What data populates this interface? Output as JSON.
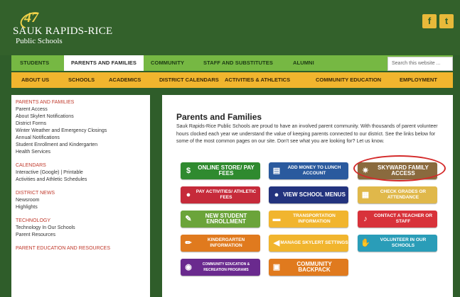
{
  "header": {
    "logo": {
      "number": "47",
      "name": "SAUK RAPIDS-RICE",
      "subtitle": "Public Schools"
    },
    "social": [
      {
        "icon": "facebook-icon",
        "glyph": "f"
      },
      {
        "icon": "twitter-icon",
        "glyph": "t"
      }
    ]
  },
  "nav_primary": {
    "items": [
      "STUDENTS",
      "PARENTS AND FAMILIES",
      "COMMUNITY",
      "STAFF AND SUBSTITUTES",
      "ALUMNI"
    ],
    "active": "PARENTS AND FAMILIES"
  },
  "search": {
    "placeholder": "Search this website ..."
  },
  "nav_secondary": {
    "items": [
      "ABOUT US",
      "SCHOOLS",
      "ACADEMICS",
      "DISTRICT CALENDARS",
      "ACTIVITIES & ATHLETICS",
      "COMMUNITY EDUCATION",
      "EMPLOYMENT"
    ]
  },
  "sidebar": {
    "sections": [
      {
        "heading": "PARENTS AND FAMILIES",
        "links": [
          "Parent Access",
          "About Skylert Notifications",
          "District Forms",
          "Winter Weather and Emergency Closings",
          "Annual Notifications",
          "Student Enrollment and Kindergarten",
          "Health Services"
        ]
      },
      {
        "heading": "CALENDARS",
        "links": [
          "Interactive (Google) | Printable",
          "Activities and Athletic Schedules"
        ]
      },
      {
        "heading": "DISTRICT NEWS",
        "links": [
          "Newsroom",
          "Highlights"
        ]
      },
      {
        "heading": "TECHNOLOGY",
        "links": [
          "Technology In Our Schools",
          "Parent Resources"
        ]
      },
      {
        "heading": "PARENT EDUCATION AND RESOURCES",
        "links": []
      }
    ]
  },
  "main": {
    "title": "Parents and Families",
    "intro": "Sauk Rapids-Rice Public Schools are proud to have an involved parent community. With thousands of parent volunteer hours clocked each year we understand the value of keeping parents connected to our district. See the links below for some of the most common pages on our site. Don't see what you are looking for? Let us know.",
    "buttons": [
      {
        "label": "ONLINE STORE/ PAY FEES",
        "icon": "dollar-icon",
        "glyph": "$",
        "color": "#2f8a2f"
      },
      {
        "label": "ADD MONEY TO LUNCH ACCOUNT",
        "icon": "lunch-tray-icon",
        "glyph": "▤",
        "color": "#2a5a9e"
      },
      {
        "label": "SKYWARD FAMILY ACCESS",
        "icon": "skyward-icon",
        "glyph": "✷",
        "color": "#8a6a3e"
      },
      {
        "label": "PAY ACTIVITIES/ ATHLETIC FEES",
        "icon": "sports-ball-icon",
        "glyph": "●",
        "color": "#c62a3a"
      },
      {
        "label": "VIEW SCHOOL MENUS",
        "icon": "apple-icon",
        "glyph": "●",
        "color": "#23337e"
      },
      {
        "label": "CHECK GRADES OR ATTENDANCE",
        "icon": "report-card-icon",
        "glyph": "▦",
        "color": "#e0b84a"
      },
      {
        "label": "NEW STUDENT ENROLLMENT",
        "icon": "pencil-icon",
        "glyph": "✎",
        "color": "#6ba43a"
      },
      {
        "label": "TRANSPORTATION INFORMATION",
        "icon": "bus-icon",
        "glyph": "▬",
        "color": "#f1b52e"
      },
      {
        "label": "CONTACT A TEACHER OR STAFF",
        "icon": "bell-icon",
        "glyph": "♪",
        "color": "#d8323a"
      },
      {
        "label": "KINDERGARTEN INFORMATION",
        "icon": "crayon-icon",
        "glyph": "✏",
        "color": "#e07a1e"
      },
      {
        "label": "MANAGE SKYLERT SETTINGS",
        "icon": "megaphone-icon",
        "glyph": "◀",
        "color": "#f1b52e"
      },
      {
        "label": "VOLUNTEER IN OUR SCHOOLS",
        "icon": "handshake-icon",
        "glyph": "✋",
        "color": "#2a9db8"
      },
      {
        "label": "COMMUNITY EDUCATION & RECREATION PROGRAMS",
        "icon": "community-ed-icon",
        "glyph": "◉",
        "color": "#6a2a8e"
      },
      {
        "label": "COMMUNITY BACKPACK",
        "icon": "backpack-icon",
        "glyph": "▣",
        "color": "#e07a1e"
      }
    ],
    "highlight_color": "#d42a2a"
  }
}
